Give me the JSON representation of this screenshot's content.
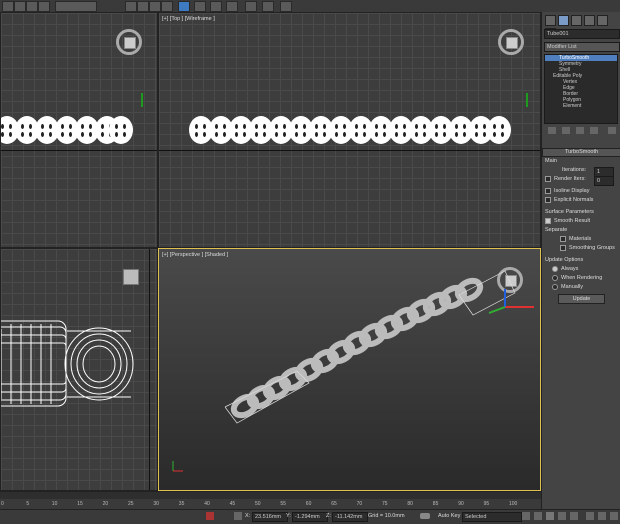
{
  "viewports": {
    "top_label": "[+] [Top ] [Wireframe ]",
    "perspective_label": "[+] [Perspective ] [Shaded ]"
  },
  "command_panel": {
    "object_name": "Tube001",
    "modifier_list_label": "Modifier List",
    "stack": [
      "TurboSmooth",
      "Symmetry",
      "Shell",
      "Editable Poly",
      "Vertex",
      "Edge",
      "Border",
      "Polygon",
      "Element"
    ],
    "selected_stack_index": 0,
    "rollout_title": "TurboSmooth",
    "main_label": "Main",
    "iterations_label": "Iterations:",
    "iterations_value": "1",
    "render_iters_label": "Render Iters:",
    "render_iters_value": "0",
    "isoline_label": "Isoline Display",
    "explicit_normals_label": "Explicit Normals",
    "surface_params_label": "Surface Parameters",
    "smooth_result_label": "Smooth Result",
    "separate_label": "Separate",
    "materials_label": "Materials",
    "smoothing_groups_label": "Smoothing Groups",
    "update_options_label": "Update Options",
    "always_label": "Always",
    "when_rendering_label": "When Rendering",
    "manually_label": "Manually",
    "update_button": "Update"
  },
  "timeline": {
    "ticks": [
      "0",
      "5",
      "10",
      "15",
      "20",
      "25",
      "30",
      "35",
      "40",
      "45",
      "50",
      "55",
      "60",
      "65",
      "70",
      "75",
      "80",
      "85",
      "90",
      "95",
      "100"
    ]
  },
  "statusbar": {
    "x_value": "23.516mm",
    "y_value": "-1.294mm",
    "z_value": "-11.142mm",
    "grid_label": "Grid = 10.0mm",
    "autokey_label": "Auto Key",
    "selected_label": "Selected"
  }
}
